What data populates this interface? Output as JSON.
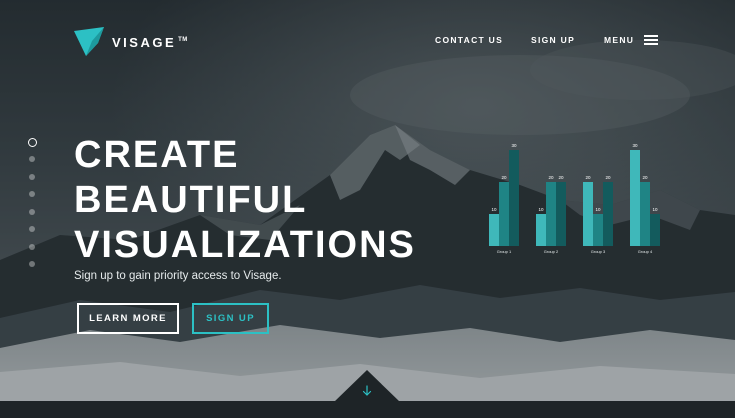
{
  "brand": {
    "name": "VISAGE",
    "tm": "TM",
    "accent": "#2cc0c4"
  },
  "nav": {
    "contact": "CONTACT US",
    "signup": "SIGN UP",
    "menu": "MENU",
    "menu_icon": "hamburger-icon"
  },
  "slider": {
    "count": 8,
    "active_index": 0
  },
  "hero": {
    "lines": [
      "CREATE",
      "BEAUTIFUL",
      "VISUALIZATIONS"
    ],
    "subtitle": "Sign up to gain priority access to Visage.",
    "learn_more": "LEARN MORE",
    "sign_up": "SIGN UP",
    "scroll_icon": "arrow-down-icon"
  },
  "chart_data": {
    "type": "bar",
    "categories": [
      "Group 1",
      "Group 2",
      "Group 3",
      "Group 4"
    ],
    "series": [
      {
        "values": [
          10,
          10,
          20,
          30
        ]
      },
      {
        "values": [
          20,
          20,
          10,
          20
        ]
      },
      {
        "values": [
          30,
          20,
          20,
          10
        ]
      }
    ],
    "colors": [
      "#3fb8ba",
      "#1f8485",
      "#135b5d"
    ],
    "ylim": [
      0,
      30
    ]
  }
}
